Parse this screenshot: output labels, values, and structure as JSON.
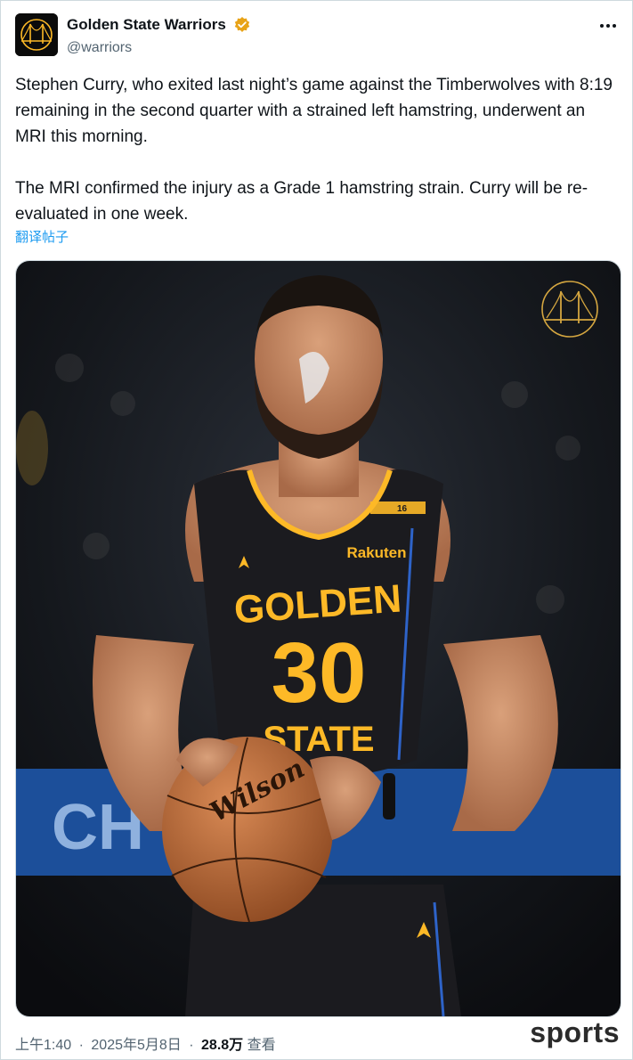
{
  "author": {
    "display_name": "Golden State Warriors",
    "handle": "@warriors",
    "verified_color": "#e8a317",
    "avatar_icon": "bridge-logo-icon"
  },
  "tweet": {
    "paragraphs": [
      "Stephen Curry, who exited last night’s game against the Timberwolves with 8:19 remaining in the second quarter with a strained left hamstring, underwent an MRI this morning.",
      "The MRI confirmed the injury as a Grade 1 hamstring strain. Curry will be re-evaluated in one week."
    ],
    "translate_label": "翻译帖子"
  },
  "media": {
    "jersey_lines": [
      "GOLDEN",
      "30",
      "STATE"
    ],
    "sponsor": "Rakuten",
    "number_tag": "16",
    "ball_brand": "Wilson",
    "backdrop_text": "CH"
  },
  "meta": {
    "time": "上午1:40",
    "date": "2025年5月8日",
    "views_count": "28.8万",
    "views_label": "查看",
    "separator": "·"
  },
  "watermark": "sports",
  "colors": {
    "link": "#1d9bf0",
    "muted": "#536471",
    "gold": "#fdb927",
    "jersey": "#1b1b1f"
  }
}
